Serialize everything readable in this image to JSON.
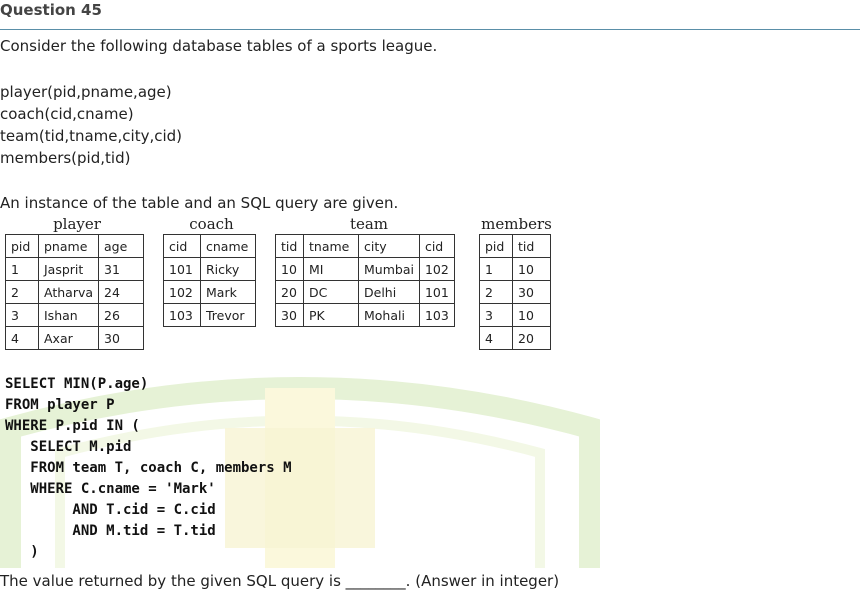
{
  "header": {
    "title": "Question 45"
  },
  "intro": "Consider the following database tables of a sports league.",
  "schema": [
    "player(pid,pname,age)",
    "coach(cid,cname)",
    "team(tid,tname,city,cid)",
    "members(pid,tid)"
  ],
  "instance_text": "An instance of the table and an SQL query are given.",
  "tables": {
    "player": {
      "caption": "player",
      "header": [
        "pid",
        "pname",
        "age"
      ],
      "rows": [
        [
          "1",
          "Jasprit",
          "31"
        ],
        [
          "2",
          "Atharva",
          "24"
        ],
        [
          "3",
          "Ishan",
          "26"
        ],
        [
          "4",
          "Axar",
          "30"
        ]
      ]
    },
    "coach": {
      "caption": "coach",
      "header": [
        "cid",
        "cname"
      ],
      "rows": [
        [
          "101",
          "Ricky"
        ],
        [
          "102",
          "Mark"
        ],
        [
          "103",
          "Trevor"
        ]
      ]
    },
    "team": {
      "caption": "team",
      "header": [
        "tid",
        "tname",
        "city",
        "cid"
      ],
      "rows": [
        [
          "10",
          "MI",
          "Mumbai",
          "102"
        ],
        [
          "20",
          "DC",
          "Delhi",
          "101"
        ],
        [
          "30",
          "PK",
          "Mohali",
          "103"
        ]
      ]
    },
    "members": {
      "caption": "members",
      "header": [
        "pid",
        "tid"
      ],
      "rows": [
        [
          "1",
          "10"
        ],
        [
          "2",
          "30"
        ],
        [
          "3",
          "10"
        ],
        [
          "4",
          "20"
        ]
      ]
    }
  },
  "sql_lines": [
    "SELECT MIN(P.age)",
    "FROM player P",
    "WHERE P.pid IN (",
    "   SELECT M.pid",
    "   FROM team T, coach C, members M",
    "   WHERE C.cname = 'Mark'",
    "        AND T.cid = C.cid",
    "        AND M.tid = T.tid",
    "   )"
  ],
  "question": "The value returned by the given SQL query is ________. (Answer in integer)"
}
